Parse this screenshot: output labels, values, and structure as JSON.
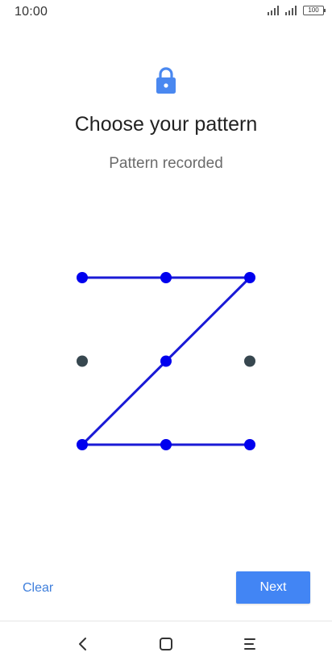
{
  "status_bar": {
    "time": "10:00",
    "battery": "100"
  },
  "header": {
    "lock_icon": "lock-icon",
    "title": "Choose your pattern",
    "subtitle": "Pattern recorded"
  },
  "pattern": {
    "grid_size": 3,
    "sequence": [
      1,
      2,
      3,
      5,
      7,
      8,
      9
    ],
    "colors": {
      "active_dot": "#0000ee",
      "inactive_dot": "#37474f",
      "line": "#1a1ad6"
    }
  },
  "actions": {
    "clear_label": "Clear",
    "next_label": "Next"
  },
  "nav_bar": {
    "back_icon": "chevron-left-icon",
    "home_icon": "square-icon",
    "menu_icon": "menu-icon"
  },
  "colors": {
    "accent": "#4285f4",
    "link": "#3f7fdc",
    "lock": "#4a88f0"
  }
}
